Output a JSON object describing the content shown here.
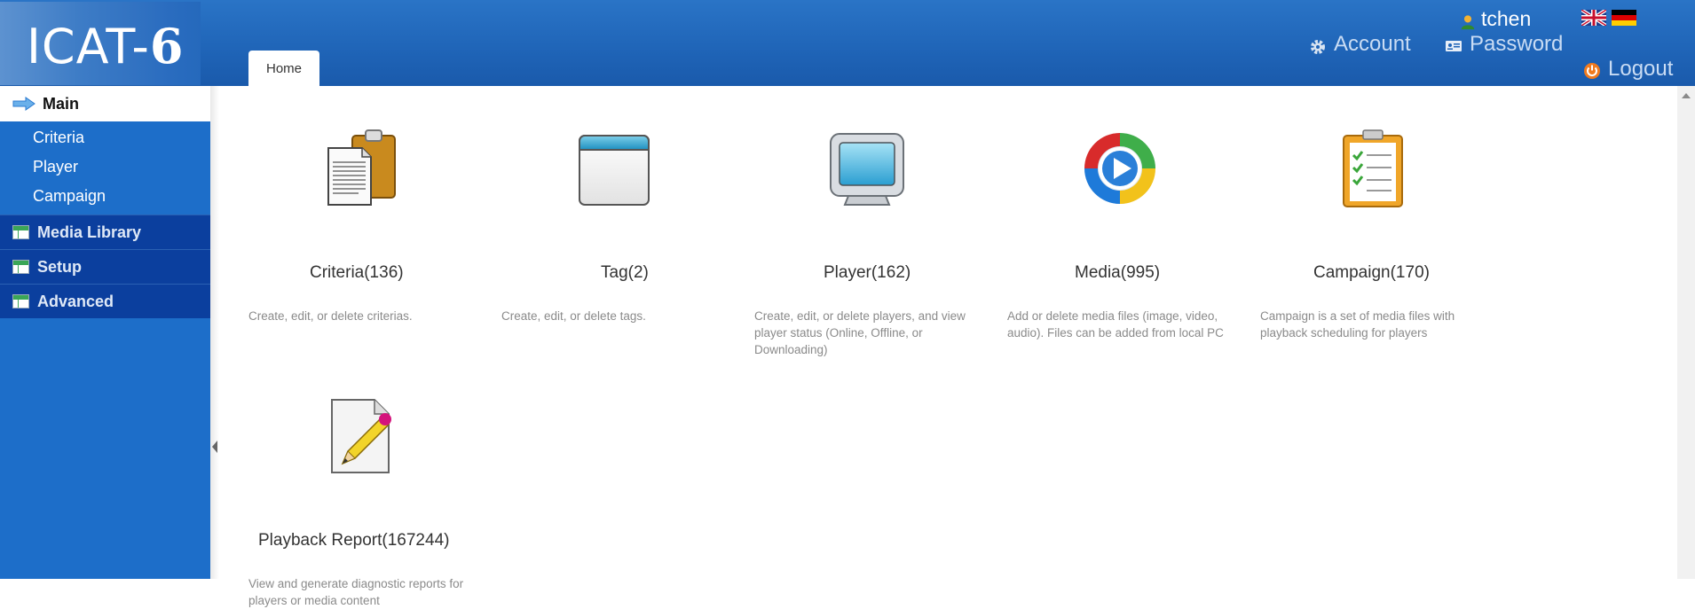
{
  "logo": {
    "text": "ICAT-",
    "number": "6"
  },
  "header": {
    "user": "tchen",
    "account_label": "Account",
    "password_label": "Password",
    "logout_label": "Logout",
    "flags": [
      "uk-flag-icon",
      "germany-flag-icon"
    ]
  },
  "tabs": [
    {
      "label": "Home"
    }
  ],
  "sidebar": {
    "main_label": "Main",
    "sub_items": [
      {
        "label": "Criteria"
      },
      {
        "label": "Player"
      },
      {
        "label": "Campaign"
      }
    ],
    "groups": [
      {
        "label": "Media Library"
      },
      {
        "label": "Setup"
      },
      {
        "label": "Advanced"
      }
    ]
  },
  "cards": [
    {
      "title": "Criteria(136)",
      "desc": "Create, edit, or delete criterias.",
      "icon": "clipboard-documents-icon"
    },
    {
      "title": "Tag(2)",
      "desc": "Create, edit, or delete tags.",
      "icon": "tag-window-icon"
    },
    {
      "title": "Player(162)",
      "desc": "Create, edit, or delete players, and view player status (Online, Offline, or Downloading)",
      "icon": "monitor-icon"
    },
    {
      "title": "Media(995)",
      "desc": "Add or delete media files (image, video, audio). Files can be added from local PC",
      "icon": "media-play-icon"
    },
    {
      "title": "Campaign(170)",
      "desc": "Campaign is a set of media files with playback scheduling for players",
      "icon": "checklist-clipboard-icon"
    },
    {
      "title": "Playback Report(167244)",
      "desc": "View and generate diagnostic reports for players or media content",
      "icon": "pencil-document-icon"
    }
  ],
  "colors": {
    "header_blue": "#1f64b7",
    "sidebar_blue": "#1d6ec9",
    "group_dark_blue": "#0b3f9e"
  }
}
